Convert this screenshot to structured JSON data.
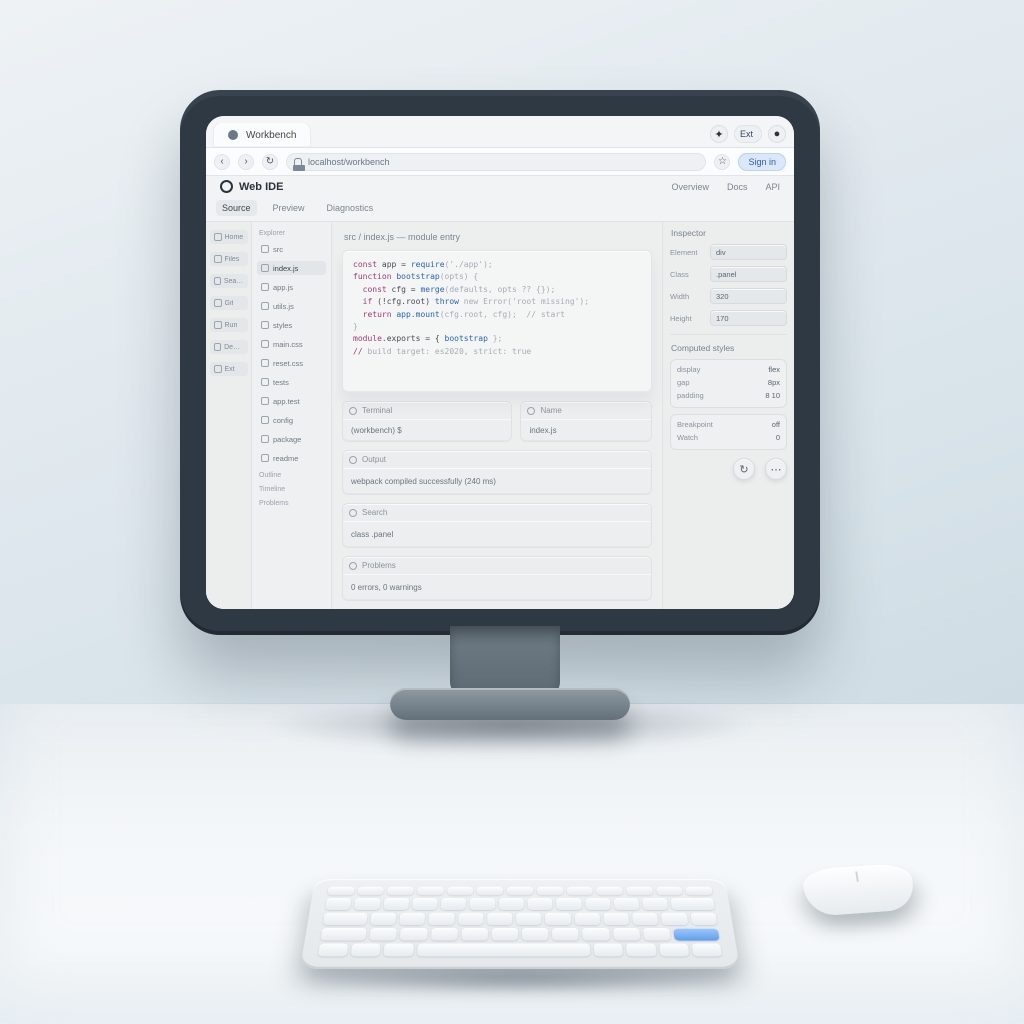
{
  "browser": {
    "tab_title": "Workbench",
    "url_text": "localhost/workbench",
    "ext_label": "Ext",
    "signin_label": "Sign in"
  },
  "app": {
    "title": "Web IDE",
    "header_links": [
      "Overview",
      "Docs",
      "API"
    ],
    "tabs": [
      "Source",
      "Preview",
      "Diagnostics"
    ],
    "active_tab_index": 0
  },
  "nav_items": [
    "Home",
    "Files",
    "Search",
    "Git",
    "Run",
    "Debug",
    "Ext"
  ],
  "file_header": "Explorer",
  "files": [
    {
      "label": "src",
      "active": false
    },
    {
      "label": "index.js",
      "active": true
    },
    {
      "label": "app.js",
      "active": false
    },
    {
      "label": "utils.js",
      "active": false
    },
    {
      "label": "styles",
      "active": false
    },
    {
      "label": "main.css",
      "active": false
    },
    {
      "label": "reset.css",
      "active": false
    },
    {
      "label": "tests",
      "active": false
    },
    {
      "label": "app.test",
      "active": false
    },
    {
      "label": "config",
      "active": false
    },
    {
      "label": "package",
      "active": false
    },
    {
      "label": "readme",
      "active": false
    }
  ],
  "file_groups": [
    "Outline",
    "Timeline",
    "Problems"
  ],
  "editor": {
    "breadcrumb": "src / index.js — module entry",
    "lines": [
      {
        "kw": "const",
        "rest": " app = ",
        "fn": "require",
        "tail": "('./app');"
      },
      {
        "kw": "function",
        "rest": " ",
        "fn": "bootstrap",
        "tail": "(opts) {"
      },
      {
        "kw": "  const",
        "rest": " cfg = ",
        "fn": "merge",
        "tail": "(defaults, opts ?? {});"
      },
      {
        "kw": "  if",
        "rest": " (!cfg.root) ",
        "fn": "throw",
        "tail": " new Error('root missing');"
      },
      {
        "kw": "  return",
        "rest": " ",
        "fn": "app.mount",
        "tail": "(cfg.root, cfg);  // start"
      },
      {
        "kw": "",
        "rest": "",
        "fn": "",
        "tail": "}"
      },
      {
        "kw": "module",
        "rest": ".exports = { ",
        "fn": "bootstrap",
        "tail": " };"
      },
      {
        "kw": "// ",
        "rest": "",
        "fn": "",
        "tail": "build target: es2020, strict: true"
      }
    ]
  },
  "panels": {
    "terminal_label": "Terminal",
    "terminal_value": "(workbench) $",
    "name_label": "Name",
    "name_value": "index.js",
    "output_label": "Output",
    "output_value": "webpack compiled successfully (240 ms)",
    "search_label": "Search",
    "search_value": "class .panel",
    "problems_label": "Problems",
    "problems_value": "0 errors, 0 warnings"
  },
  "inspector": {
    "header": "Inspector",
    "fields": [
      {
        "label": "Element",
        "value": "div"
      },
      {
        "label": "Class",
        "value": ".panel"
      },
      {
        "label": "Width",
        "value": "320"
      },
      {
        "label": "Height",
        "value": "170"
      }
    ],
    "meta_label": "Computed styles",
    "box": [
      {
        "tag": "display",
        "val": "flex"
      },
      {
        "tag": "gap",
        "val": "8px"
      },
      {
        "tag": "padding",
        "val": "8 10"
      }
    ],
    "actions_box": [
      {
        "tag": "Breakpoint",
        "val": "off"
      },
      {
        "tag": "Watch",
        "val": "0"
      }
    ],
    "round_a_icon": "↻",
    "round_b_icon": "⋯"
  }
}
